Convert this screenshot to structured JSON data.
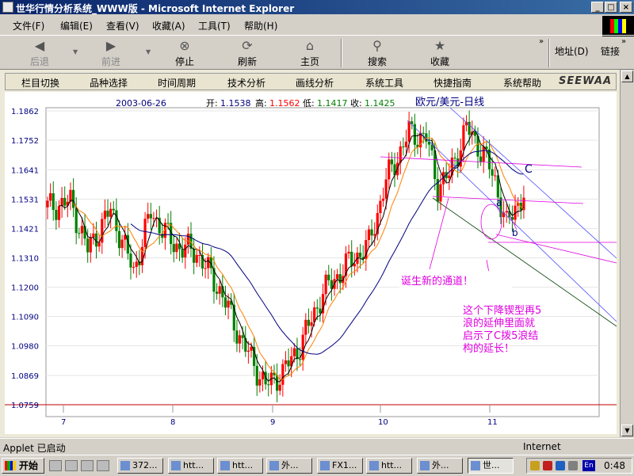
{
  "window": {
    "title": "世华行情分析系统_WWW版 - Microsoft Internet Explorer"
  },
  "menu": [
    "文件(F)",
    "编辑(E)",
    "查看(V)",
    "收藏(A)",
    "工具(T)",
    "帮助(H)"
  ],
  "toolbar": [
    {
      "label": "后退",
      "icon": "back-arrow-icon",
      "disabled": true
    },
    {
      "label": "前进",
      "icon": "forward-arrow-icon",
      "disabled": true
    },
    {
      "label": "停止",
      "icon": "stop-icon",
      "disabled": false
    },
    {
      "label": "刷新",
      "icon": "refresh-icon",
      "disabled": false
    },
    {
      "label": "主页",
      "icon": "home-icon",
      "disabled": false
    },
    {
      "label": "搜索",
      "icon": "search-icon",
      "disabled": false
    },
    {
      "label": "收藏",
      "icon": "favorites-icon",
      "disabled": false
    }
  ],
  "address_label": "地址(D)",
  "links_label": "链接",
  "app_nav": [
    "栏目切换",
    "品种选择",
    "时间周期",
    "技术分析",
    "画线分析",
    "系统工具",
    "快捷指南",
    "系统帮助"
  ],
  "brand": "SEEWAA",
  "ohlc": {
    "date": "2003-06-26",
    "open_label": "开:",
    "open": "1.1538",
    "high_label": "高:",
    "high": "1.1562",
    "low_label": "低:",
    "low": "1.1417",
    "close_label": "收:",
    "close": "1.1425"
  },
  "chart_data": {
    "type": "candlestick",
    "title": "欧元/美元-日线",
    "y_ticks": [
      "1.1862",
      "1.1752",
      "1.1641",
      "1.1531",
      "1.1421",
      "1.1310",
      "1.1200",
      "1.1090",
      "1.0980",
      "1.0869",
      "1.0759"
    ],
    "ylim": [
      1.0759,
      1.1862
    ],
    "x_ticks": [
      "7",
      "8",
      "9",
      "10",
      "11"
    ],
    "colors": {
      "up": "#ff0000",
      "down": "#008000",
      "ma_short": "#000000",
      "ma_mid": "#ff8000",
      "ma_long": "#000080"
    },
    "annotations": {
      "wave_c": "C",
      "wave_a": "a",
      "wave_b": "b",
      "note1": "诞生新的通道！",
      "note2": [
        "这个下降锲型再5",
        "浪的延伸里面就",
        "启示了C拨5浪结",
        "构的延长！"
      ]
    }
  },
  "status": {
    "text": "Applet 已启动",
    "zone": "Internet"
  },
  "taskbar": {
    "start": "开始",
    "tasks": [
      "372...",
      "htt...",
      "htt...",
      "外...",
      "FX1...",
      "htt...",
      "外...",
      "世..."
    ],
    "clock": "0:48",
    "lang": "En"
  }
}
